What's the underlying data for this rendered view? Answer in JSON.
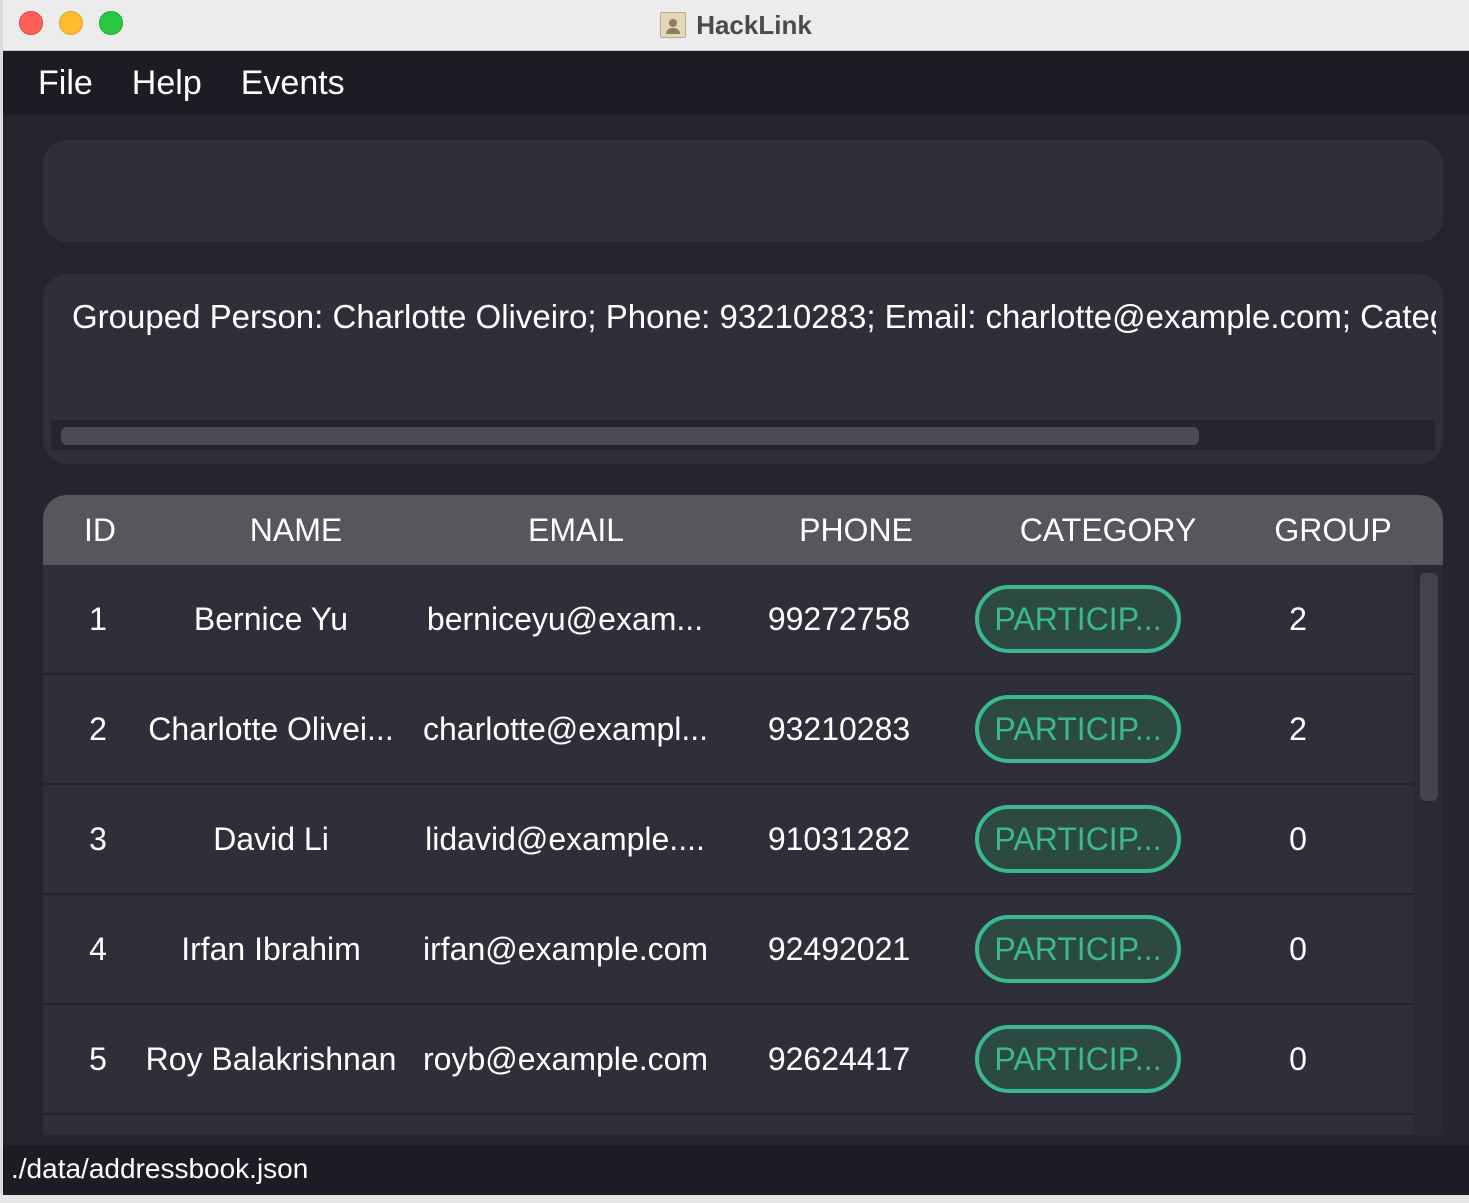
{
  "window": {
    "title": "HackLink"
  },
  "menu": [
    "File",
    "Help",
    "Events"
  ],
  "command_box": {
    "value": ""
  },
  "result": {
    "text": "Grouped Person: Charlotte Oliveiro; Phone: 93210283; Email: charlotte@example.com; Catego"
  },
  "table": {
    "headers": [
      "ID",
      "NAME",
      "EMAIL",
      "PHONE",
      "CATEGORY",
      "GROUP"
    ],
    "rows": [
      {
        "id": "1",
        "name": "Bernice Yu",
        "email": "berniceyu@exam...",
        "phone": "99272758",
        "category": "PARTICIP...",
        "group": "2"
      },
      {
        "id": "2",
        "name": "Charlotte Olivei...",
        "email": "charlotte@exampl...",
        "phone": "93210283",
        "category": "PARTICIP...",
        "group": "2"
      },
      {
        "id": "3",
        "name": "David Li",
        "email": "lidavid@example....",
        "phone": "91031282",
        "category": "PARTICIP...",
        "group": "0"
      },
      {
        "id": "4",
        "name": "Irfan Ibrahim",
        "email": "irfan@example.com",
        "phone": "92492021",
        "category": "PARTICIP...",
        "group": "0"
      },
      {
        "id": "5",
        "name": "Roy Balakrishnan",
        "email": "royb@example.com",
        "phone": "92624417",
        "category": "PARTICIP...",
        "group": "0"
      }
    ]
  },
  "status": {
    "path": "./data/addressbook.json"
  },
  "colors": {
    "accent": "#3bb88f",
    "background": "#25252d",
    "panel": "#2f2f39",
    "header": "#56565d"
  }
}
